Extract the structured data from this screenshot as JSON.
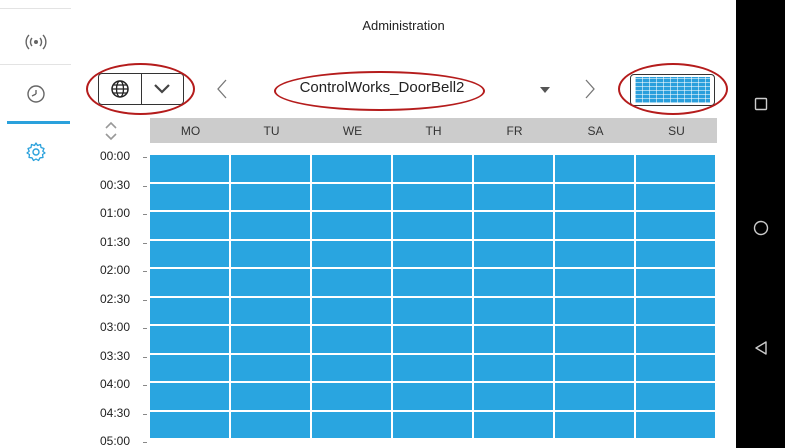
{
  "app": {
    "title": "Administration"
  },
  "sidebar": {
    "items": [
      {
        "icon": "radio-signal-icon"
      },
      {
        "icon": "clock-icon"
      },
      {
        "icon": "gear-icon",
        "active": true
      }
    ],
    "active_color": "#2aa1dc"
  },
  "toolbar": {
    "device_name": "ControlWorks_DoorBell2",
    "timezone_icon": "globe-icon",
    "expand_icon": "chevron-down-icon",
    "prev_icon": "chevron-left-icon",
    "next_icon": "chevron-right-icon",
    "dropdown_icon": "caret-down-icon",
    "mode_icon": "schedule-grid-icon"
  },
  "schedule": {
    "days": [
      "MO",
      "TU",
      "WE",
      "TH",
      "FR",
      "SA",
      "SU"
    ],
    "times": [
      "00:00",
      "00:30",
      "01:00",
      "01:30",
      "02:00",
      "02:30",
      "03:00",
      "03:30",
      "04:00",
      "04:30",
      "05:00"
    ],
    "active_color": "#29a5e0",
    "header_color": "#cccccc"
  },
  "annotation_color": "#b51c1c",
  "navbar": {
    "buttons": [
      "recents-square-icon",
      "home-circle-icon",
      "back-triangle-icon"
    ]
  }
}
